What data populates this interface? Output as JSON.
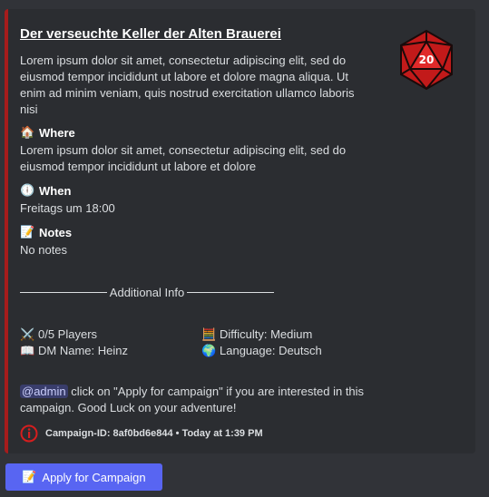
{
  "campaign": {
    "title": "Der verseuchte Keller der Alten Brauerei",
    "description": "Lorem ipsum dolor sit amet, consectetur adipiscing elit, sed do eiusmod tempor incididunt ut labore et dolore magna aliqua. Ut enim ad minim veniam, quis nostrud exercitation ullamco laboris nisi",
    "where_label": "Where",
    "where_value": "Lorem ipsum dolor sit amet, consectetur adipiscing elit, sed do eiusmod tempor incididunt ut labore et dolore",
    "when_label": "When",
    "when_value": "Freitags um 18:00",
    "notes_label": "Notes",
    "notes_value": "No notes",
    "additional_info_label": "Additional Info",
    "players": "0/5 Players",
    "difficulty": "Difficulty: Medium",
    "dm_name": "DM Name: Heinz",
    "language": "Language: Deutsch",
    "mention": "@admin",
    "note_text": " click on \"Apply for campaign\" if you are interested in this campaign. Good Luck on your adventure!",
    "footer": "Campaign-ID: 8af0bd6e844 • Today at 1:39 PM",
    "dice_number": "20"
  },
  "apply_button": {
    "label": "Apply for Campaign"
  },
  "colors": {
    "accent_bar": "#a61c1c",
    "button": "#5865f2",
    "mention_text": "#c9cdfb"
  },
  "icons": [
    "d20-dice-icon",
    "house-icon",
    "clock-icon",
    "memo-icon",
    "crossed-swords-icon",
    "abacus-icon",
    "book-icon",
    "globe-icon",
    "info-icon"
  ]
}
